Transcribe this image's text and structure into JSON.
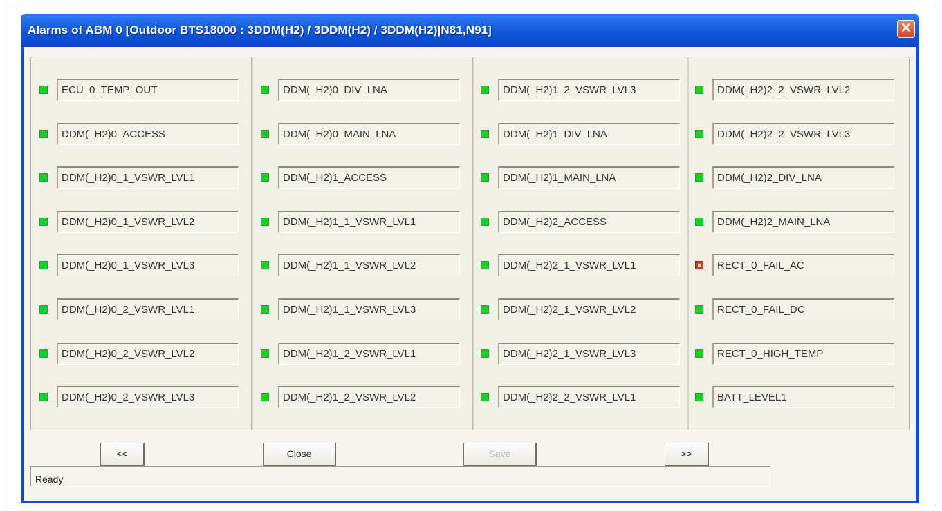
{
  "window": {
    "title": "Alarms of ABM 0  [Outdoor BTS18000   : 3DDM(H2) / 3DDM(H2) / 3DDM(H2)|N81,N91]",
    "close_glyph": "✕"
  },
  "alarms": {
    "columns": [
      [
        {
          "label": "ECU_0_TEMP_OUT",
          "status": "green"
        },
        {
          "label": "DDM(_H2)0_ACCESS",
          "status": "green"
        },
        {
          "label": "DDM(_H2)0_1_VSWR_LVL1",
          "status": "green"
        },
        {
          "label": "DDM(_H2)0_1_VSWR_LVL2",
          "status": "green"
        },
        {
          "label": "DDM(_H2)0_1_VSWR_LVL3",
          "status": "green"
        },
        {
          "label": "DDM(_H2)0_2_VSWR_LVL1",
          "status": "green"
        },
        {
          "label": "DDM(_H2)0_2_VSWR_LVL2",
          "status": "green"
        },
        {
          "label": "DDM(_H2)0_2_VSWR_LVL3",
          "status": "green"
        }
      ],
      [
        {
          "label": "DDM(_H2)0_DIV_LNA",
          "status": "green"
        },
        {
          "label": "DDM(_H2)0_MAIN_LNA",
          "status": "green"
        },
        {
          "label": "DDM(_H2)1_ACCESS",
          "status": "green"
        },
        {
          "label": "DDM(_H2)1_1_VSWR_LVL1",
          "status": "green"
        },
        {
          "label": "DDM(_H2)1_1_VSWR_LVL2",
          "status": "green"
        },
        {
          "label": "DDM(_H2)1_1_VSWR_LVL3",
          "status": "green"
        },
        {
          "label": "DDM(_H2)1_2_VSWR_LVL1",
          "status": "green"
        },
        {
          "label": "DDM(_H2)1_2_VSWR_LVL2",
          "status": "green"
        }
      ],
      [
        {
          "label": "DDM(_H2)1_2_VSWR_LVL3",
          "status": "green"
        },
        {
          "label": "DDM(_H2)1_DIV_LNA",
          "status": "green"
        },
        {
          "label": "DDM(_H2)1_MAIN_LNA",
          "status": "green"
        },
        {
          "label": "DDM(_H2)2_ACCESS",
          "status": "green"
        },
        {
          "label": "DDM(_H2)2_1_VSWR_LVL1",
          "status": "green"
        },
        {
          "label": "DDM(_H2)2_1_VSWR_LVL2",
          "status": "green"
        },
        {
          "label": "DDM(_H2)2_1_VSWR_LVL3",
          "status": "green"
        },
        {
          "label": "DDM(_H2)2_2_VSWR_LVL1",
          "status": "green"
        }
      ],
      [
        {
          "label": "DDM(_H2)2_2_VSWR_LVL2",
          "status": "green"
        },
        {
          "label": "DDM(_H2)2_2_VSWR_LVL3",
          "status": "green"
        },
        {
          "label": "DDM(_H2)2_DIV_LNA",
          "status": "green"
        },
        {
          "label": "DDM(_H2)2_MAIN_LNA",
          "status": "green"
        },
        {
          "label": "RECT_0_FAIL_AC",
          "status": "red"
        },
        {
          "label": "RECT_0_FAIL_DC",
          "status": "green"
        },
        {
          "label": "RECT_0_HIGH_TEMP",
          "status": "green"
        },
        {
          "label": "BATT_LEVEL1",
          "status": "green"
        }
      ]
    ]
  },
  "buttons": {
    "prev_label": "<<",
    "close_label": "Close",
    "save_label": "Save",
    "next_label": ">>"
  },
  "status": {
    "text": "Ready"
  }
}
